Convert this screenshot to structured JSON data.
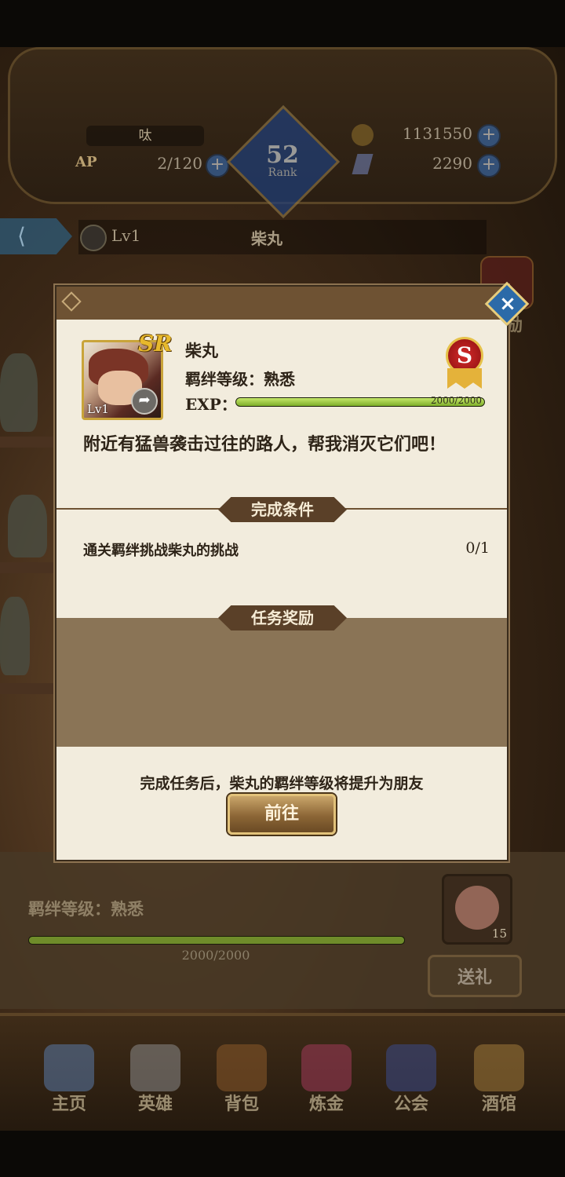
{
  "header": {
    "player_name": "呔",
    "ap_label": "AP",
    "ap_value": "2/120",
    "rank_number": "52",
    "rank_label": "Rank",
    "gold": "1131550",
    "gems": "2290"
  },
  "hero_bar": {
    "level": "Lv1",
    "name": "柴丸",
    "side_label": "励"
  },
  "modal": {
    "hero_name": "柴丸",
    "rarity": "SR",
    "portrait_level": "Lv1",
    "bond_level": "羁绊等级：熟悉",
    "exp_label": "EXP：",
    "exp_value": "2000/2000",
    "exp_fraction": 1.0,
    "rank_grade": "S",
    "description": "附近有猛兽袭击过往的路人，帮我消灭它们吧！",
    "conditions_title": "完成条件",
    "condition_text": "通关羁绊挑战柴丸的挑战",
    "condition_progress": "0/1",
    "rewards_title": "任务奖励",
    "note": "完成任务后，柴丸的羁绊等级将提升为朋友",
    "go_button": "前往"
  },
  "lower_panel": {
    "bond_level": "羁绊等级：熟悉",
    "exp_value": "2000/2000",
    "exp_fraction": 1.0,
    "gift_count": "15",
    "send_gift_button": "送礼"
  },
  "nav": [
    {
      "label": "主页",
      "icon": "castle-icon",
      "color": "#5a7aa8"
    },
    {
      "label": "英雄",
      "icon": "helmet-icon",
      "color": "#8a8a8a"
    },
    {
      "label": "背包",
      "icon": "backpack-icon",
      "color": "#8a5a2a"
    },
    {
      "label": "炼金",
      "icon": "potion-icon",
      "color": "#a03a5a"
    },
    {
      "label": "公会",
      "icon": "shield-icon",
      "color": "#3a4a8a"
    },
    {
      "label": "酒馆",
      "icon": "tavern-icon",
      "color": "#a07a3a"
    }
  ]
}
